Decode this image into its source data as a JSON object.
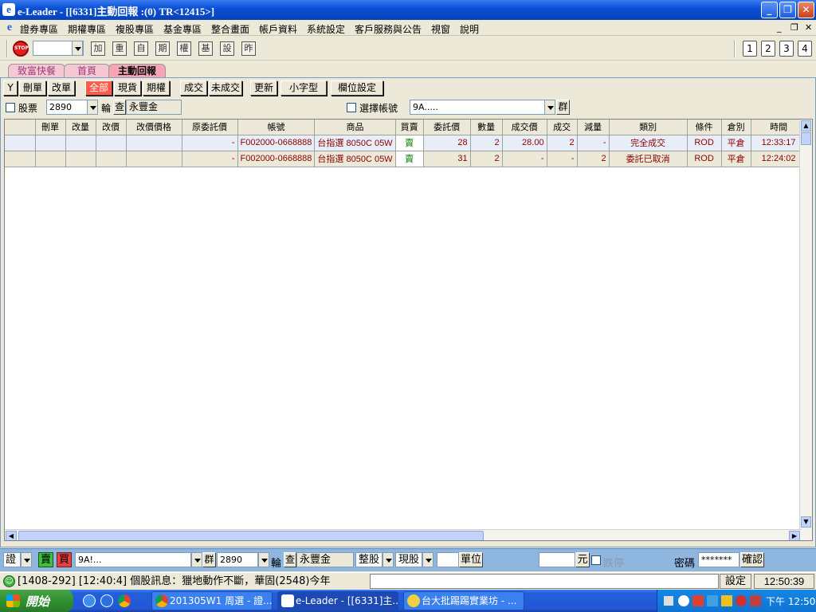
{
  "window": {
    "title": "e-Leader - [[6331]主動回報 :(0) TR<12415>]",
    "app_icon": "e",
    "controls": [
      "_",
      "❐",
      "✕"
    ]
  },
  "menu": {
    "icon": "e",
    "items": [
      "證券專區",
      "期權專區",
      "複股專區",
      "基金專區",
      "整合畫面",
      "帳戶資料",
      "系統設定",
      "客戶服務與公告",
      "視窗",
      "說明"
    ],
    "mdi_controls": [
      "_",
      "❐",
      "✕"
    ]
  },
  "toolbar": {
    "stop_icon": "STOP",
    "quick_buttons": [
      "加",
      "重",
      "自",
      "期",
      "權",
      "基",
      "設",
      "昨"
    ],
    "number_buttons": [
      "1",
      "2",
      "3",
      "4"
    ]
  },
  "tabs": [
    {
      "label": "致富快餐",
      "active": false
    },
    {
      "label": "首頁",
      "active": false
    },
    {
      "label": "主動回報",
      "active": true
    }
  ],
  "filters": {
    "funnel": "Y",
    "buttons": [
      "刪單",
      "改單"
    ],
    "type_buttons": [
      "全部",
      "現貨",
      "期權"
    ],
    "status_buttons": [
      "成交",
      "未成交"
    ],
    "refresh": "更新",
    "small_font": "小字型",
    "column_settings": "欄位設定"
  },
  "search": {
    "stock_label": "股票",
    "stock_code": "2890",
    "rotate_label": "輪",
    "query_label": "查",
    "stock_name": "永豐金",
    "account_select_label": "選擇帳號",
    "account_value": "9A.....",
    "group_label": "群"
  },
  "grid": {
    "columns": [
      "",
      "刪單",
      "改量",
      "改價",
      "改價價格",
      "原委託價",
      "帳號",
      "商品",
      "買賣",
      "委託價",
      "數量",
      "成交價",
      "成交",
      "減量",
      "類別",
      "條件",
      "倉別",
      "時間"
    ],
    "rows": [
      {
        "orig_price": "-",
        "account": "F002000-0668888",
        "product": "台指選 8050C 05W",
        "side": "賣",
        "order_price": "28",
        "qty": "2",
        "fill_price": "28.00",
        "filled": "2",
        "reduced": "-",
        "category": "完全成交",
        "condition": "ROD",
        "position": "平倉",
        "time": "12:33:17"
      },
      {
        "orig_price": "-",
        "account": "F002000-0668888",
        "product": "台指選 8050C 05W",
        "side": "賣",
        "order_price": "31",
        "qty": "2",
        "fill_price": "-",
        "filled": "-",
        "reduced": "2",
        "category": "委託已取消",
        "condition": "ROD",
        "position": "平倉",
        "time": "12:24:02"
      }
    ]
  },
  "order_bar": {
    "market": "證",
    "buy_label": "賣",
    "sell_label": "買",
    "account": "9A!...",
    "group": "群",
    "code": "2890",
    "rotate": "輪",
    "query": "查",
    "name": "永豐金",
    "lot_type": "整股",
    "trade_type": "現股",
    "unit_label": "單位",
    "price_unit": "元",
    "stop_loss_label": "跌停",
    "password_label": "密碼",
    "password_mask": "*******",
    "confirm": "確認"
  },
  "status": {
    "message": "[1408-292] [12:40:4] 個股訊息：獵地動作不斷，華固(2548)今年",
    "settings": "設定",
    "clock": "12:50:39"
  },
  "taskbar": {
    "start": "開始",
    "tasks": [
      {
        "label": "201305W1 周選 - 證...",
        "active": false
      },
      {
        "label": "e-Leader - [[6331]主...",
        "active": true
      },
      {
        "label": "台大批踢踢實業坊 - ...",
        "active": false
      }
    ],
    "clock": "下午 12:50"
  }
}
